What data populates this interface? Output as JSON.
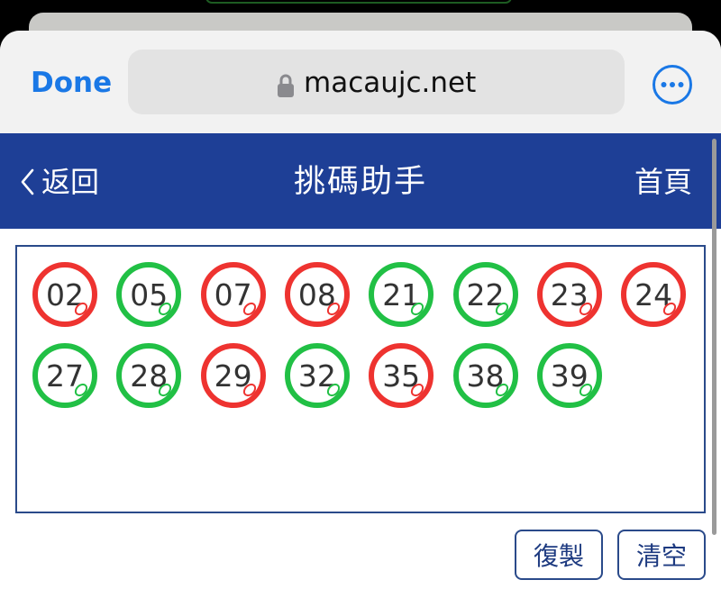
{
  "browser": {
    "done_label": "Done",
    "url": "macaujc.net",
    "accent_color": "#1a78e6"
  },
  "header": {
    "back_label": "返回",
    "title": "挑碼助手",
    "home_label": "首頁",
    "background_color": "#1e3f96"
  },
  "balls": [
    {
      "number": "02",
      "color": "red"
    },
    {
      "number": "05",
      "color": "green"
    },
    {
      "number": "07",
      "color": "red"
    },
    {
      "number": "08",
      "color": "red"
    },
    {
      "number": "21",
      "color": "green"
    },
    {
      "number": "22",
      "color": "green"
    },
    {
      "number": "23",
      "color": "red"
    },
    {
      "number": "24",
      "color": "red"
    },
    {
      "number": "27",
      "color": "green"
    },
    {
      "number": "28",
      "color": "green"
    },
    {
      "number": "29",
      "color": "red"
    },
    {
      "number": "32",
      "color": "green"
    },
    {
      "number": "35",
      "color": "red"
    },
    {
      "number": "38",
      "color": "green"
    },
    {
      "number": "39",
      "color": "green"
    }
  ],
  "actions": {
    "copy_label": "復製",
    "clear_label": "清空"
  },
  "colors": {
    "red_ball": "#ee3330",
    "green_ball": "#21c045"
  }
}
